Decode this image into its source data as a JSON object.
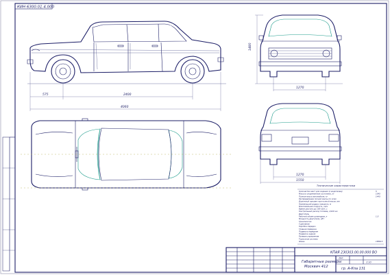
{
  "drawing": {
    "header_code": "КИН 6300.01.4.000",
    "side_view": {
      "dim_front_overhang": "575",
      "dim_wheelbase": "2400",
      "dim_total_length": "4060"
    },
    "front_view": {
      "dim_height": "1480",
      "dim_track": "1270"
    },
    "rear_view": {
      "dim_track": "1270",
      "dim_width": "1550"
    },
    "specs": {
      "heading": "Технические характеристики",
      "lines": [
        "Количество мест для сидения (с водителем)",
        "Масса в снаряженном состоянии, кг",
        "Полная масса автомобиля, кг",
        "Распределение полной массы по осям",
        "Дорожный просвет при полной массе, мм",
        "Наименьший радиус поворота, м",
        "Максимальная скорость, км/ч",
        "Время разгона до 100 км/ч, с",
        "Контрольный расход топлива, л/100 км",
        "Двигатель",
        "Рабочий объем цилиндров, л",
        "Мощность двигателя, кВт",
        "Трансмиссия",
        "Сцепление",
        "Коробка передач",
        "Главная передача",
        "Подвеска передняя",
        "Подвеска задняя",
        "Рулевое управление",
        "Тормозная система",
        "Шины"
      ],
      "values": [
        "5",
        "1045",
        "1445",
        "",
        "",
        "",
        "",
        "",
        "",
        "",
        "1,5",
        "",
        "",
        "",
        "",
        "",
        "",
        "",
        "",
        "",
        "165R13"
      ]
    },
    "title_block": {
      "code": "КПАЯ 230303.00.00.000 ВО",
      "title_line1": "Габаритные размеры",
      "title_line2": "Москвич 412",
      "sheet_label": "Лит.",
      "scale": "1:10",
      "org": "гр. А-Кпа 131"
    }
  }
}
